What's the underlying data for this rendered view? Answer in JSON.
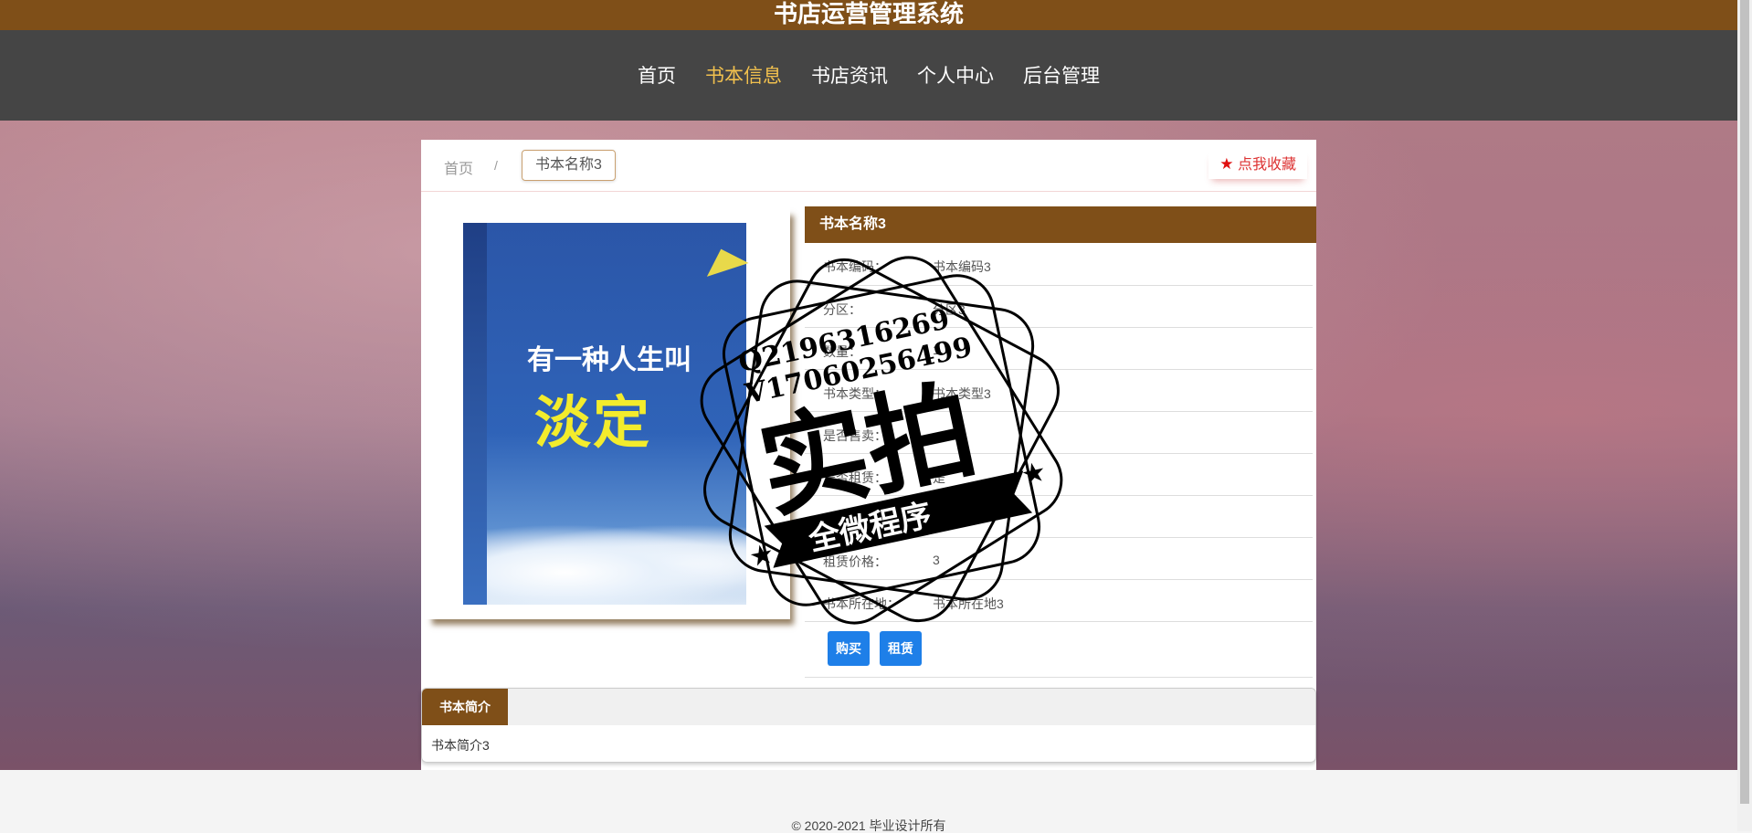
{
  "site": {
    "title": "书店运营管理系统"
  },
  "nav": {
    "items": [
      {
        "label": "首页"
      },
      {
        "label": "书本信息"
      },
      {
        "label": "书店资讯"
      },
      {
        "label": "个人中心"
      },
      {
        "label": "后台管理"
      }
    ]
  },
  "breadcrumb": {
    "home": "首页",
    "separator": "/",
    "current": "书本名称3"
  },
  "favorite": {
    "label": "点我收藏"
  },
  "cover": {
    "title_line1": "有一种人生叫",
    "title_line2": "淡定"
  },
  "detail": {
    "title": "书本名称3",
    "rows": [
      {
        "label": "书本编码：",
        "value": "书本编码3"
      },
      {
        "label": "分区：",
        "value": "分区3"
      },
      {
        "label": "数量：",
        "value": "1"
      },
      {
        "label": "书本类型：",
        "value": "书本类型3"
      },
      {
        "label": "是否售卖：",
        "value": ""
      },
      {
        "label": "是否租赁：",
        "value": "是"
      },
      {
        "label": "",
        "value": ""
      },
      {
        "label": "租赁价格：",
        "value": "3"
      },
      {
        "label": "书本所在地：",
        "value": "书本所在地3"
      }
    ],
    "buy_label": "购买",
    "rent_label": "租赁"
  },
  "tabs": {
    "intro_label": "书本简介",
    "intro_text": "书本简介3"
  },
  "watermark": {
    "line1": "Q2196316269",
    "line2": "V17060256499",
    "main": "实拍",
    "banner": "全微程序"
  },
  "footer": {
    "copyright": "© 2020-2021 毕业设计所有"
  },
  "colors": {
    "brand": "#7f4f18",
    "nav_bg": "#454545",
    "nav_active": "#f2c14e",
    "button": "#1e7fe8"
  }
}
